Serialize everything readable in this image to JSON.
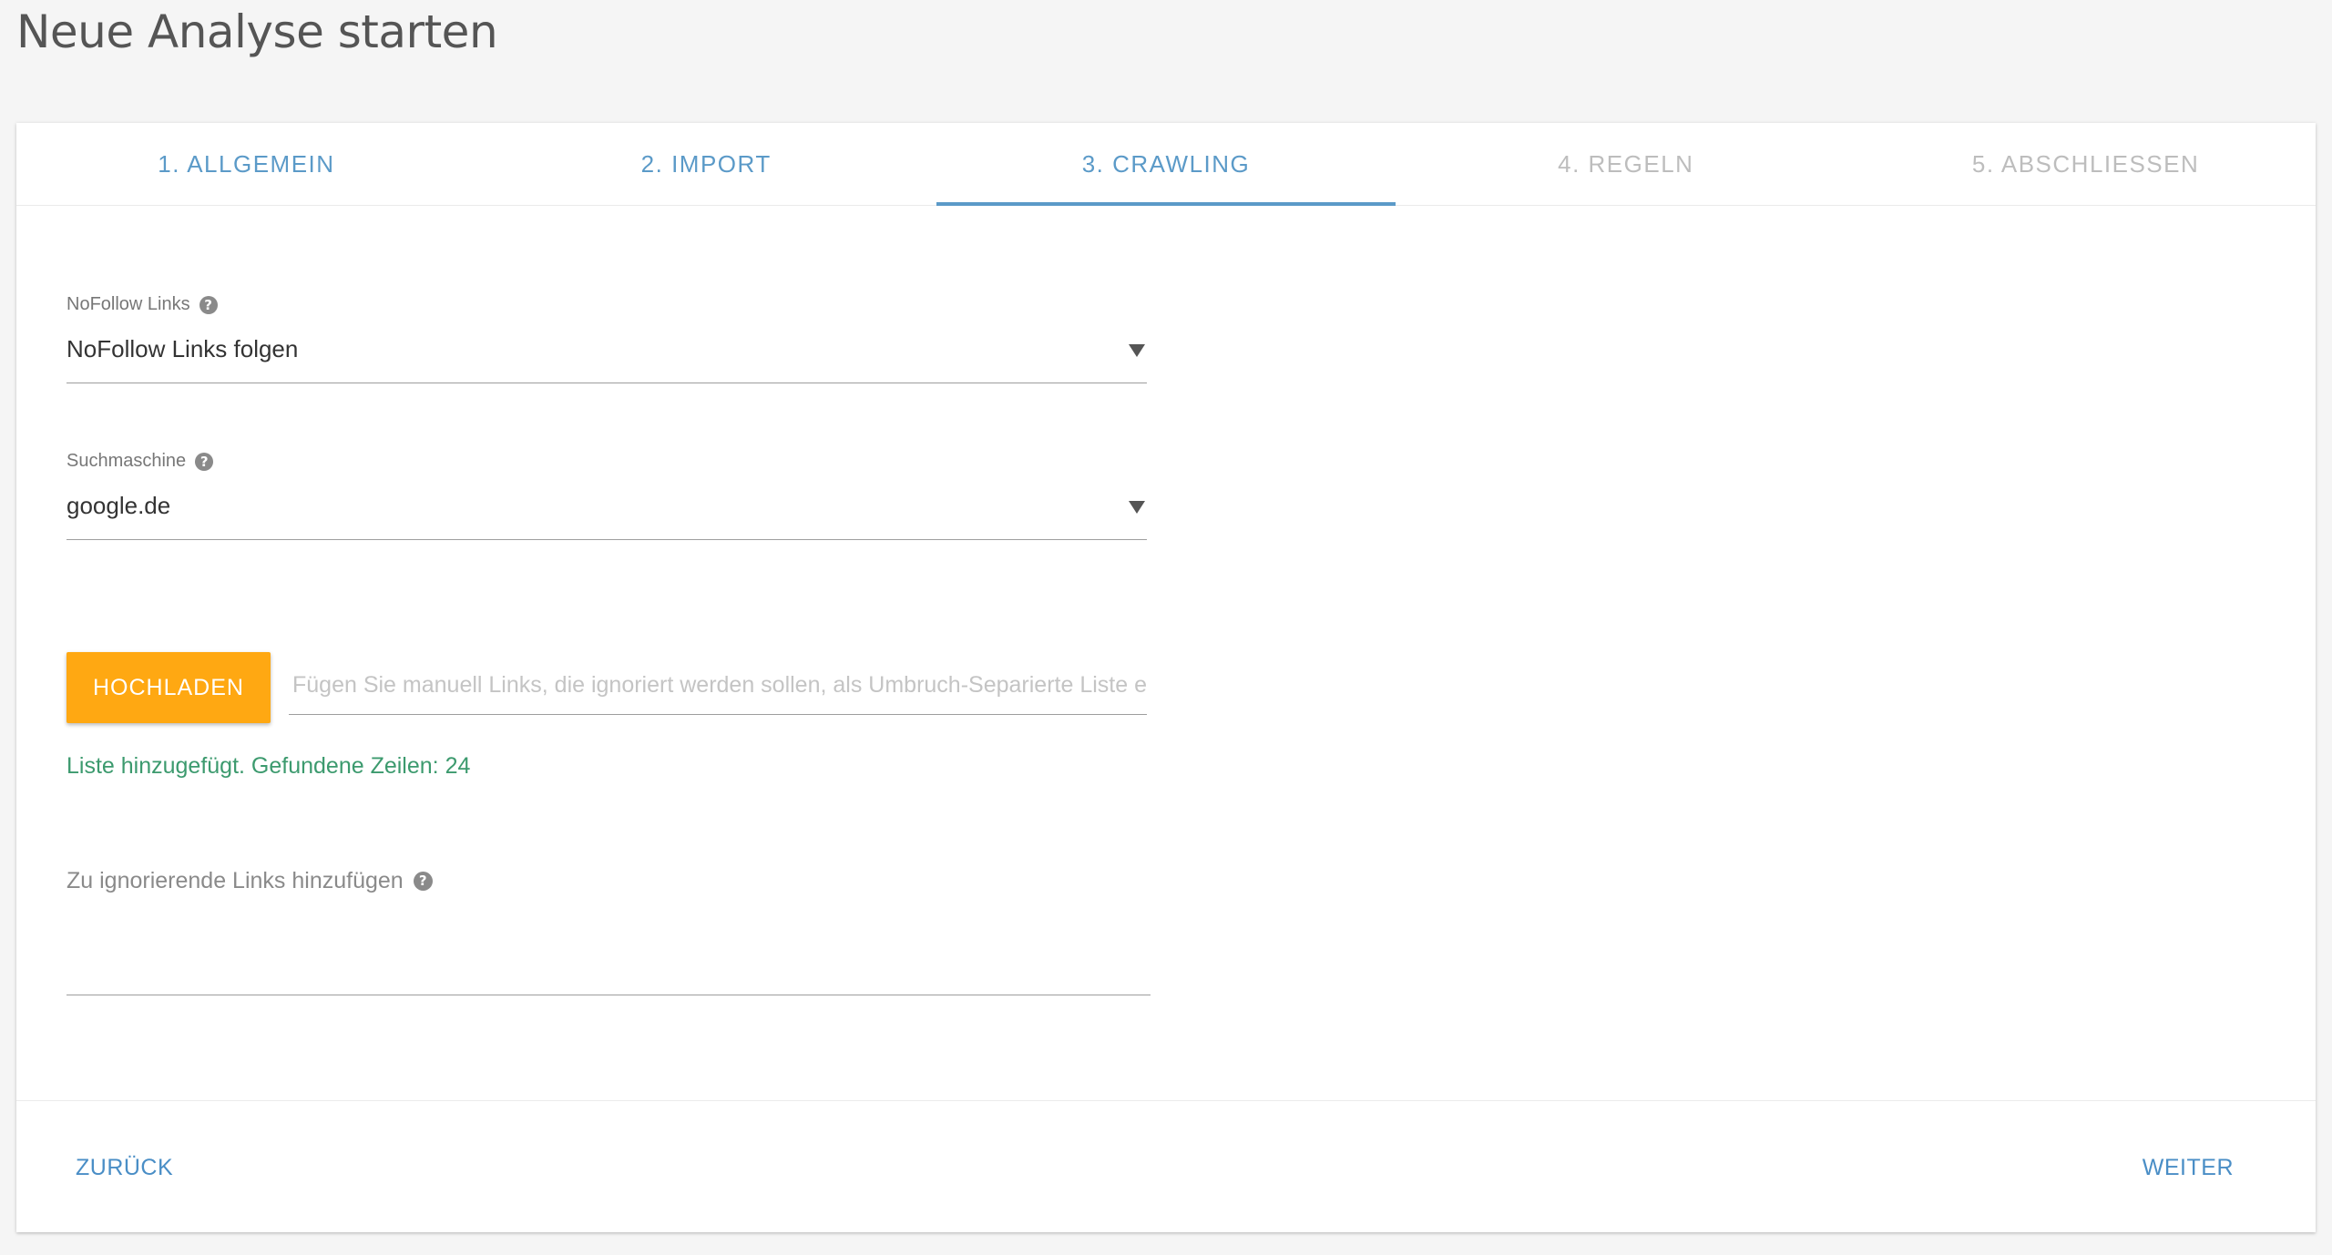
{
  "page": {
    "title": "Neue Analyse starten"
  },
  "tabs": [
    {
      "label": "1. ALLGEMEIN",
      "state": "done"
    },
    {
      "label": "2. IMPORT",
      "state": "done"
    },
    {
      "label": "3. CRAWLING",
      "state": "active"
    },
    {
      "label": "4. REGELN",
      "state": "disabled"
    },
    {
      "label": "5. ABSCHLIESSEN",
      "state": "disabled"
    }
  ],
  "form": {
    "nofollow": {
      "label": "NoFollow Links",
      "value": "NoFollow Links folgen",
      "help_icon": "question-circle-icon"
    },
    "search_engine": {
      "label": "Suchmaschine",
      "value": "google.de",
      "help_icon": "question-circle-icon"
    },
    "upload": {
      "button_label": "HOCHLADEN",
      "input_placeholder": "Fügen Sie manuell Links, die ignoriert werden sollen, als Umbruch-Separierte Liste ein",
      "status": "Liste hinzugefügt. Gefundene Zeilen: 24"
    },
    "ignore_links": {
      "label": "Zu ignorierende Links hinzufügen",
      "value": "",
      "help_icon": "question-circle-icon"
    }
  },
  "footer": {
    "back_label": "ZURÜCK",
    "next_label": "WEITER"
  },
  "colors": {
    "accent": "#5b9ac8",
    "disabled_tab": "#bdbdbd",
    "upload_button": "#ffa812",
    "success_text": "#3c9a6e",
    "background": "#f5f5f5"
  }
}
